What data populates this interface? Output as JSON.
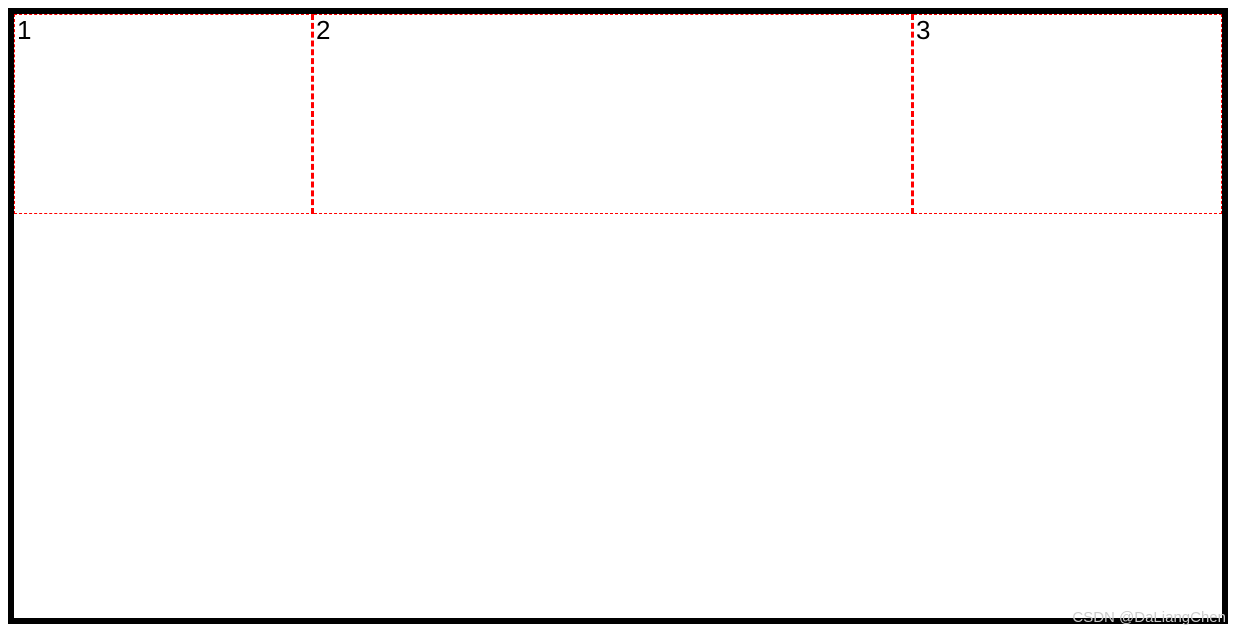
{
  "grid": {
    "cells": [
      {
        "label": "1"
      },
      {
        "label": "2"
      },
      {
        "label": "3"
      }
    ]
  },
  "watermark": "CSDN @DaLiangChen",
  "colors": {
    "border_outer": "#000000",
    "border_inner_dashed": "#ff0000",
    "background": "#ffffff",
    "text": "#000000",
    "watermark": "#cccccc"
  }
}
